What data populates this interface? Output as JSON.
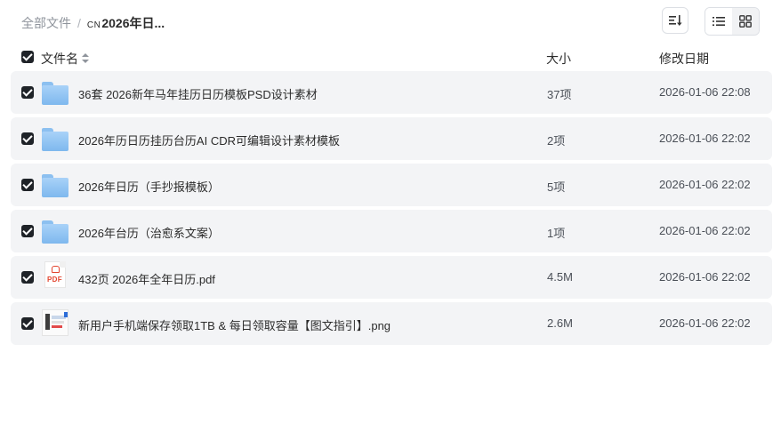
{
  "breadcrumb": {
    "root": "全部文件",
    "separator": "/",
    "current_prefix": "CN",
    "current": "2026年日..."
  },
  "toolbar": {
    "sort_icon": "sort-icon",
    "list_view_icon": "list-view-icon",
    "grid_view_icon": "grid-view-icon",
    "active_view": "list"
  },
  "table": {
    "headers": {
      "name": "文件名",
      "size": "大小",
      "date": "修改日期"
    },
    "rows": [
      {
        "type": "folder",
        "name": "36套 2026新年马年挂历日历模板PSD设计素材",
        "size": "37项",
        "date": "2026-01-06 22:08",
        "checked": true
      },
      {
        "type": "folder",
        "name": "2026年历日历挂历台历AI CDR可编辑设计素材模板",
        "size": "2项",
        "date": "2026-01-06 22:02",
        "checked": true
      },
      {
        "type": "folder",
        "name": "2026年日历（手抄报模板）",
        "size": "5项",
        "date": "2026-01-06 22:02",
        "checked": true
      },
      {
        "type": "folder",
        "name": "2026年台历（治愈系文案）",
        "size": "1项",
        "date": "2026-01-06 22:02",
        "checked": true
      },
      {
        "type": "pdf",
        "name": "432页 2026年全年日历.pdf",
        "size": "4.5M",
        "date": "2026-01-06 22:02",
        "checked": true,
        "icon_label": "PDF"
      },
      {
        "type": "png",
        "name": "新用户手机端保存领取1TB & 每日领取容量【图文指引】.png",
        "size": "2.6M",
        "date": "2026-01-06 22:02",
        "checked": true
      }
    ]
  },
  "colors": {
    "row_bg": "#f3f4f6",
    "checkbox": "#1f2328",
    "folder": "#8cc0f0",
    "pdf_red": "#e2452f"
  }
}
